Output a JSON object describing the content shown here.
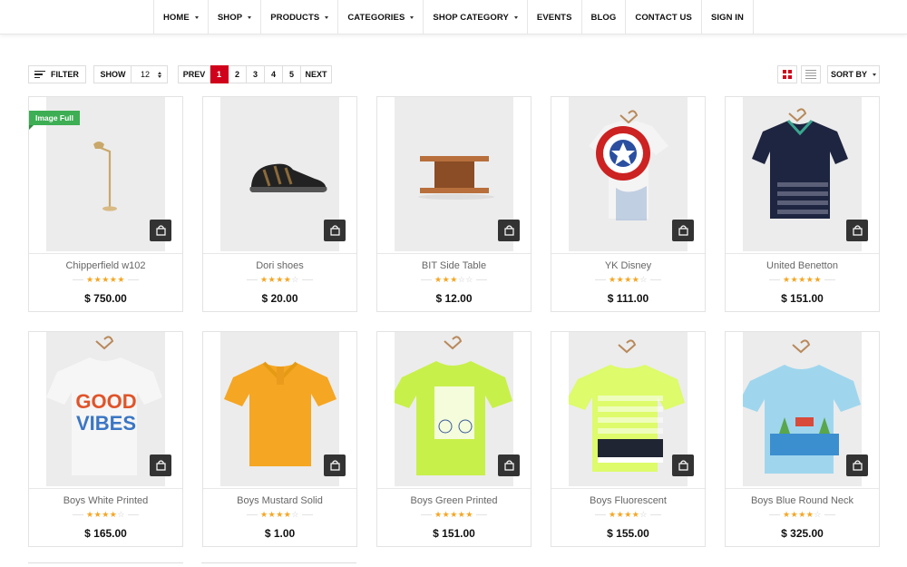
{
  "nav": [
    {
      "label": "HOME",
      "caret": true
    },
    {
      "label": "SHOP",
      "caret": true
    },
    {
      "label": "PRODUCTS",
      "caret": true
    },
    {
      "label": "CATEGORIES",
      "caret": true
    },
    {
      "label": "SHOP CATEGORY",
      "caret": true
    },
    {
      "label": "EVENTS",
      "caret": false
    },
    {
      "label": "BLOG",
      "caret": false
    },
    {
      "label": "CONTACT US",
      "caret": false
    },
    {
      "label": "SIGN IN",
      "caret": false
    }
  ],
  "toolbar": {
    "filter_label": "FILTER",
    "show_label": "SHOW",
    "show_value": "12",
    "prev_label": "PREV",
    "next_label": "NEXT",
    "pages": [
      "1",
      "2",
      "3",
      "4",
      "5"
    ],
    "active_page": "1",
    "sort_label": "SORT BY",
    "accent_color": "#d0021b"
  },
  "badge_label": "Image Full",
  "products": [
    {
      "name": "Chipperfield w102",
      "rating": 5,
      "price": "$ 750.00",
      "image": "floor-lamp",
      "badge": true
    },
    {
      "name": "Dori shoes",
      "rating": 4,
      "price": "$ 20.00",
      "image": "sneaker"
    },
    {
      "name": "BIT Side Table",
      "rating": 3,
      "price": "$ 12.00",
      "image": "side-table"
    },
    {
      "name": "YK Disney",
      "rating": 4,
      "price": "$ 111.00",
      "image": "shield-tshirt"
    },
    {
      "name": "United Benetton",
      "rating": 5,
      "price": "$ 151.00",
      "image": "navy-polo"
    },
    {
      "name": "Boys White Printed",
      "rating": 4,
      "price": "$ 165.00",
      "image": "good-vibes-tshirt"
    },
    {
      "name": "Boys Mustard Solid",
      "rating": 4,
      "price": "$ 1.00",
      "image": "mustard-polo"
    },
    {
      "name": "Boys Green Printed",
      "rating": 5,
      "price": "$ 151.00",
      "image": "green-tshirt"
    },
    {
      "name": "Boys Fluorescent",
      "rating": 4,
      "price": "$ 155.00",
      "image": "fluorescent-striped-tshirt"
    },
    {
      "name": "Boys Blue Round Neck",
      "rating": 4,
      "price": "$ 325.00",
      "image": "blue-printed-tshirt"
    }
  ]
}
